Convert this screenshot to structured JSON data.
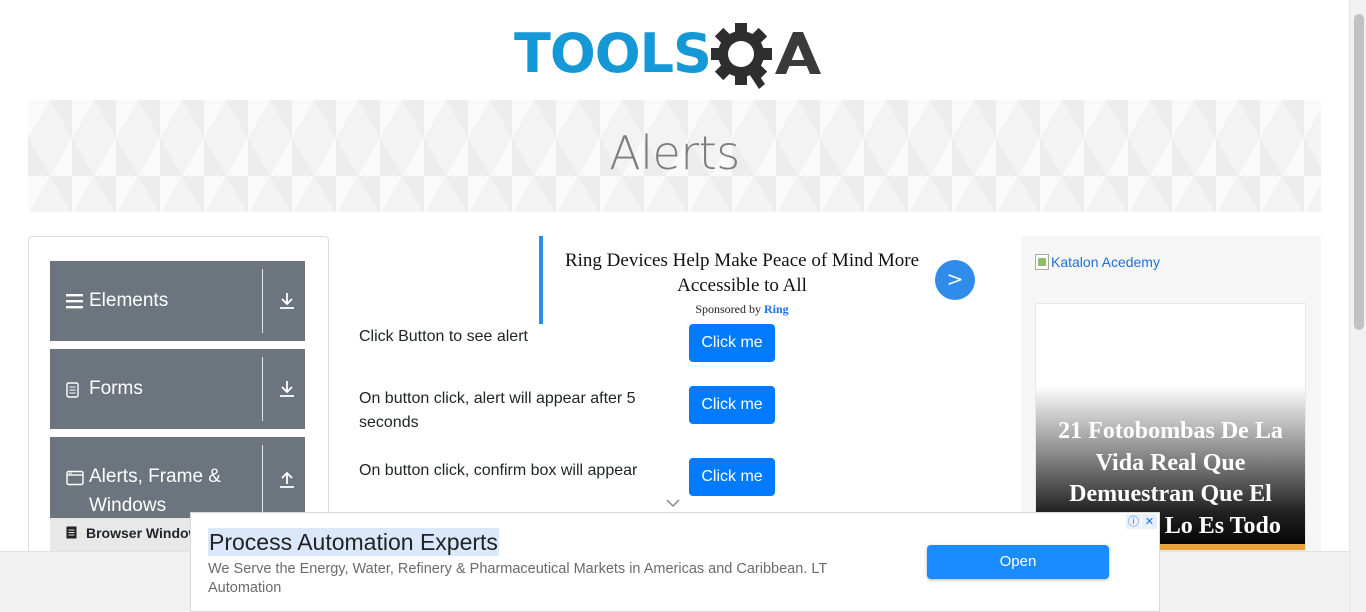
{
  "logo": {
    "text_part": "TOOLS",
    "mark_part": "QA",
    "colors": {
      "tools": "#1598d6",
      "qa": "#3a3a3a"
    }
  },
  "banner": {
    "title": "Alerts"
  },
  "sidebar": {
    "groups": [
      {
        "label": "Elements",
        "icon": "hamburger-icon",
        "arrow": "download-arrow-icon"
      },
      {
        "label": "Forms",
        "icon": "document-icon",
        "arrow": "download-arrow-icon"
      },
      {
        "label": "Alerts, Frame & Windows",
        "icon": "window-icon",
        "arrow": "upload-arrow-icon"
      }
    ],
    "subitem": {
      "label": "Browser Windows",
      "icon": "document-icon"
    }
  },
  "ad_top": {
    "headline": "Ring Devices Help Make Peace of Mind More Accessible to All",
    "sponsored_prefix": "Sponsored by ",
    "sponsor": "Ring",
    "go_label": ">"
  },
  "alerts": {
    "rows": [
      {
        "text": "Click Button to see alert",
        "button": "Click me"
      },
      {
        "text": "On button click, alert will appear after 5 seconds",
        "button": "Click me"
      },
      {
        "text": "On button click, confirm box will appear",
        "button": "Click me"
      }
    ]
  },
  "right_ad": {
    "image_alt": "Katalon Acedemy",
    "card_text": "21 Fotobombas De La Vida Real Que Demuestran Que El Momento Lo Es Todo"
  },
  "bottom_ad": {
    "title": "Process Automation Experts",
    "description": "We Serve the Energy, Water, Refinery & Pharmaceutical Markets in Americas and Caribbean. LT Automation",
    "open_label": "Open",
    "info_icon": "ⓘ",
    "close_icon": "✕"
  },
  "colors": {
    "accent_blue": "#007bff",
    "sidebar_gray": "#6c757d",
    "banner_text": "#7d7d7d"
  }
}
